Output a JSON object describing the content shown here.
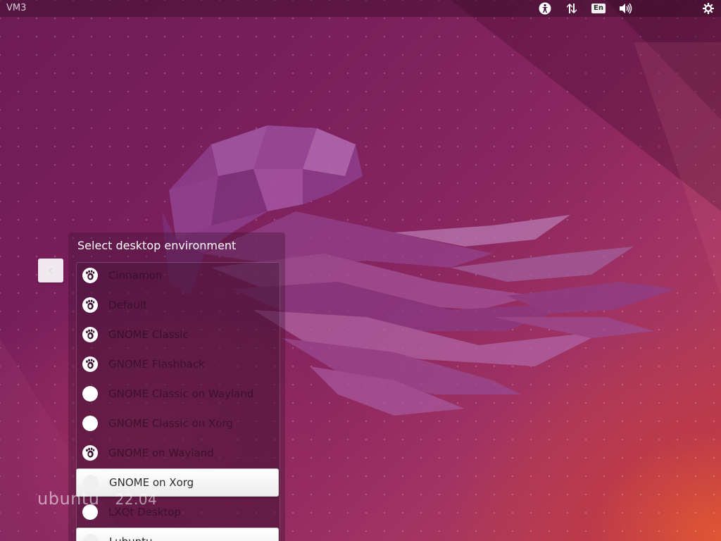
{
  "top_panel": {
    "hostname": "VM3",
    "icons": [
      "accessibility-icon",
      "network-icon",
      "keyboard-layout-icon",
      "volume-icon",
      "power-settings-icon"
    ],
    "keyboard_layout": "En"
  },
  "branding": {
    "name": "ubuntu",
    "version": "22.04"
  },
  "session_dialog": {
    "title": "Select desktop environment",
    "back_icon": "chevron-left-icon",
    "sessions": [
      {
        "label": "Cinnamon",
        "icon": "gnome-foot-icon",
        "highlighted": false
      },
      {
        "label": "Default",
        "icon": "gnome-foot-icon",
        "highlighted": false
      },
      {
        "label": "GNOME Classic",
        "icon": "gnome-foot-icon",
        "highlighted": false
      },
      {
        "label": "GNOME Flashback",
        "icon": "gnome-foot-icon",
        "highlighted": false
      },
      {
        "label": "GNOME Classic on Wayland",
        "icon": "blank-circle-icon",
        "highlighted": false
      },
      {
        "label": "GNOME Classic on Xorg",
        "icon": "blank-circle-icon",
        "highlighted": false
      },
      {
        "label": "GNOME on Wayland",
        "icon": "gnome-foot-icon",
        "highlighted": false
      },
      {
        "label": "GNOME on Xorg",
        "icon": "blank-circle-icon",
        "highlighted": true
      },
      {
        "label": "LXQt Desktop",
        "icon": "blank-circle-icon",
        "highlighted": false
      },
      {
        "label": "Lubuntu",
        "icon": "blank-circle-icon",
        "highlighted": true
      }
    ]
  },
  "colors": {
    "wallpaper_base": "#7a1f5c",
    "wallpaper_accent": "#e25632",
    "jellyfish": "#a24e9a"
  }
}
